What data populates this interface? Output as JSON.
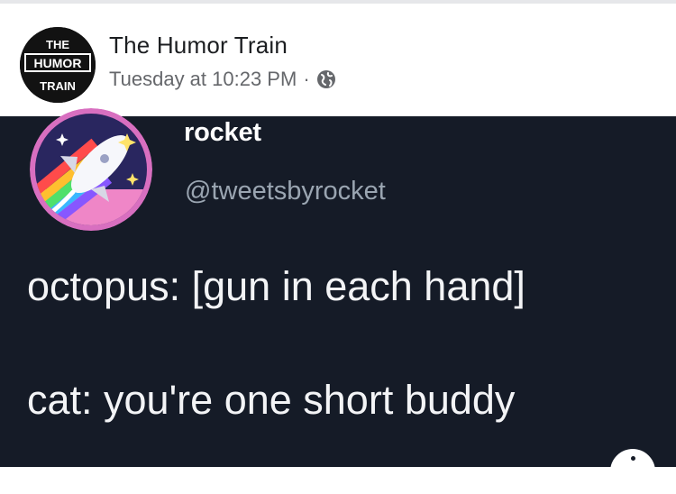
{
  "post": {
    "page_name": "The Humor Train",
    "timestamp": "Tuesday at 10:23 PM",
    "separator": "·",
    "audience_icon": "globe-icon",
    "avatar_logo": {
      "line1": "THE",
      "line2": "HUMOR",
      "line3": "TRAIN"
    }
  },
  "tweet": {
    "display_name": "rocket",
    "handle": "@tweetsbyrocket",
    "avatar_icon": "rocket-rainbow-icon",
    "lines": [
      "octopus: [gun in each hand]",
      "cat: you're one short buddy"
    ]
  },
  "colors": {
    "tweet_background": "#151b27",
    "header_background": "#ffffff",
    "meta_text": "#65676b"
  }
}
